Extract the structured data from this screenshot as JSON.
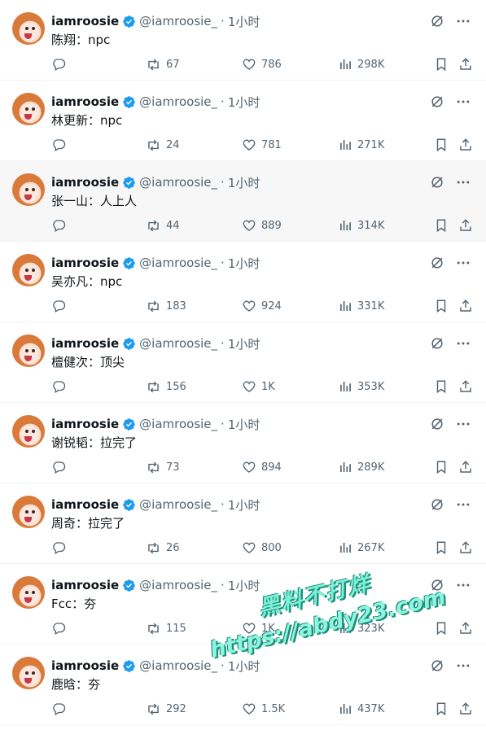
{
  "tweets": [
    {
      "name": "iamroosie",
      "handle": "@iamroosie_",
      "dot": "·",
      "time": "1小时",
      "text": "陈翔：npc",
      "retweets": "67",
      "likes": "786",
      "views": "298K"
    },
    {
      "name": "iamroosie",
      "handle": "@iamroosie_",
      "dot": "·",
      "time": "1小时",
      "text": "林更新：npc",
      "retweets": "24",
      "likes": "781",
      "views": "271K"
    },
    {
      "name": "iamroosie",
      "handle": "@iamroosie_",
      "dot": "·",
      "time": "1小时",
      "text": "张一山：人上人",
      "retweets": "44",
      "likes": "889",
      "views": "314K"
    },
    {
      "name": "iamroosie",
      "handle": "@iamroosie_",
      "dot": "·",
      "time": "1小时",
      "text": "吴亦凡：npc",
      "retweets": "183",
      "likes": "924",
      "views": "331K"
    },
    {
      "name": "iamroosie",
      "handle": "@iamroosie_",
      "dot": "·",
      "time": "1小时",
      "text": "檀健次：顶尖",
      "retweets": "156",
      "likes": "1K",
      "views": "353K"
    },
    {
      "name": "iamroosie",
      "handle": "@iamroosie_",
      "dot": "·",
      "time": "1小时",
      "text": "谢锐韬：拉完了",
      "retweets": "73",
      "likes": "894",
      "views": "289K"
    },
    {
      "name": "iamroosie",
      "handle": "@iamroosie_",
      "dot": "·",
      "time": "1小时",
      "text": "周奇：拉完了",
      "retweets": "26",
      "likes": "800",
      "views": "267K"
    },
    {
      "name": "iamroosie",
      "handle": "@iamroosie_",
      "dot": "·",
      "time": "1小时",
      "text": "Fcc：夯",
      "retweets": "115",
      "likes": "1K",
      "views": "323K"
    },
    {
      "name": "iamroosie",
      "handle": "@iamroosie_",
      "dot": "·",
      "time": "1小时",
      "text": "鹿晗：夯",
      "retweets": "292",
      "likes": "1.5K",
      "views": "437K"
    }
  ],
  "watermark": {
    "line1": "黑料不打烊",
    "line2": "https://abdy23.com"
  },
  "colors": {
    "text": "#0f1419",
    "muted": "#536471",
    "verified": "#1d9bf0",
    "hover_bg": "#f7f7f7",
    "watermark": "#7ff0d8"
  },
  "icons": [
    "grok-icon",
    "more-icon",
    "reply-icon",
    "retweet-icon",
    "like-icon",
    "views-icon",
    "bookmark-icon",
    "share-icon",
    "verified-icon"
  ]
}
